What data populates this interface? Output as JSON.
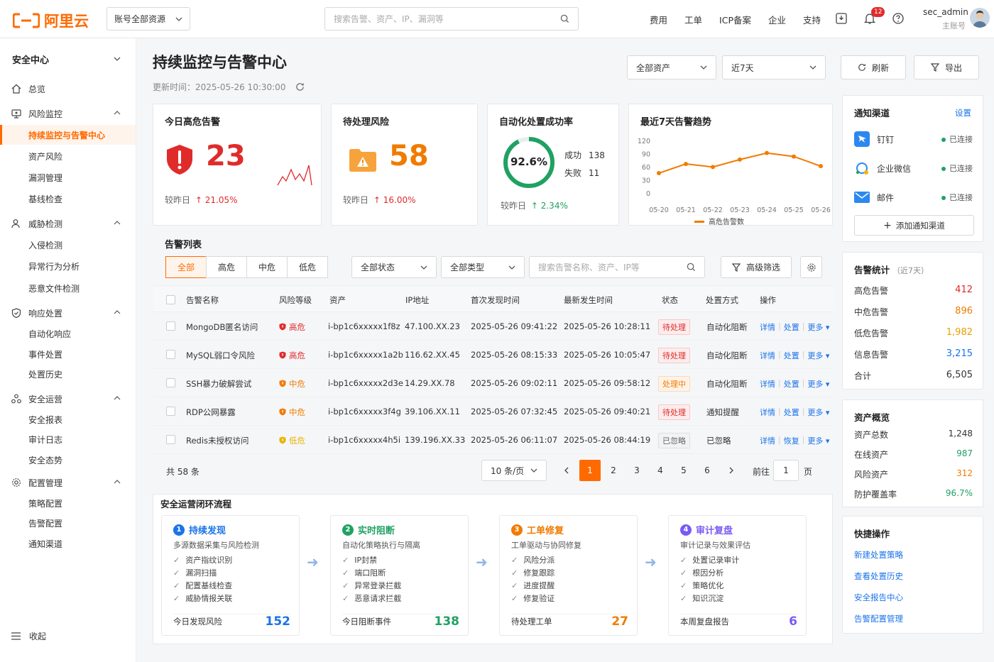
{
  "brand": {
    "name": "阿里云",
    "accent": "#ff6a00"
  },
  "topbar": {
    "account_select": "账号全部资源",
    "search_placeholder": "搜索告警、资产、IP、漏洞等",
    "nav": [
      "费用",
      "工单",
      "ICP备案",
      "企业",
      "支持"
    ],
    "badge": "12",
    "user": {
      "name": "sec_admin",
      "role": "主账号"
    }
  },
  "sidebar": {
    "title": "安全中心",
    "items": [
      {
        "label": "总览",
        "icon": "home-icon",
        "type": "top"
      },
      {
        "label": "风险监控",
        "icon": "monitor-icon",
        "type": "group"
      },
      {
        "label": "持续监控与告警中心",
        "type": "sub",
        "active": true
      },
      {
        "label": "资产风险",
        "type": "sub"
      },
      {
        "label": "漏洞管理",
        "type": "sub"
      },
      {
        "label": "基线检查",
        "type": "sub"
      },
      {
        "label": "威胁检测",
        "icon": "user-shield-icon",
        "type": "group"
      },
      {
        "label": "入侵检测",
        "type": "sub"
      },
      {
        "label": "异常行为分析",
        "type": "sub"
      },
      {
        "label": "恶意文件检测",
        "type": "sub"
      },
      {
        "label": "响应处置",
        "icon": "shield-check-icon",
        "type": "group"
      },
      {
        "label": "自动化响应",
        "type": "sub"
      },
      {
        "label": "事件处置",
        "type": "sub"
      },
      {
        "label": "处置历史",
        "type": "sub"
      },
      {
        "label": "安全运营",
        "icon": "ops-icon",
        "type": "group"
      },
      {
        "label": "安全报表",
        "type": "sub"
      },
      {
        "label": "审计日志",
        "type": "sub"
      },
      {
        "label": "安全态势",
        "type": "sub"
      },
      {
        "label": "配置管理",
        "icon": "gear-icon",
        "type": "group"
      },
      {
        "label": "策略配置",
        "type": "sub"
      },
      {
        "label": "告警配置",
        "type": "sub"
      },
      {
        "label": "通知渠道",
        "type": "sub"
      }
    ],
    "collapse": "收起"
  },
  "header": {
    "title": "持续监控与告警中心",
    "updated": "更新时间：2025-05-26 10:30:00",
    "asset_filter": "全部资产",
    "range_filter": "近7天",
    "refresh": "刷新",
    "export": "导出"
  },
  "cards": {
    "high_alert": {
      "title": "今日高危告警",
      "value": "23",
      "cmp_label": "较昨日",
      "cmp_value": "21.05%"
    },
    "pending_risk": {
      "title": "待处理风险",
      "value": "58",
      "cmp_label": "较昨日",
      "cmp_value": "16.00%"
    },
    "auto_rate": {
      "title": "自动化处置成功率",
      "value": "92.6%",
      "success_label": "成功",
      "success_value": "138",
      "fail_label": "失败",
      "fail_value": "11",
      "cmp_label": "较昨日",
      "cmp_value": "2.34%",
      "rate": 0.926
    }
  },
  "chart_data": {
    "type": "line",
    "title": "最近7天告警趋势",
    "x": [
      "05-20",
      "05-21",
      "05-22",
      "05-23",
      "05-24",
      "05-25",
      "05-26"
    ],
    "series": [
      {
        "name": "高危告警数",
        "values": [
          47,
          68,
          61,
          78,
          93,
          85,
          63
        ],
        "color": "#f17b00"
      }
    ],
    "yticks": [
      "120",
      "90",
      "60",
      "30",
      "0"
    ],
    "ylim": [
      0,
      120
    ]
  },
  "alerts": {
    "section_title": "告警列表",
    "tabs": [
      "全部",
      "高危",
      "中危",
      "低危"
    ],
    "status_filter": "全部状态",
    "type_filter": "全部类型",
    "search_placeholder": "搜索告警名称、资产、IP等",
    "adv_filter": "高级筛选",
    "columns": [
      "告警名称",
      "风险等级",
      "资产",
      "IP地址",
      "首次发现时间",
      "最新发生时间",
      "状态",
      "处置方式",
      "操作"
    ],
    "rows": [
      {
        "name": "MongoDB匿名访问",
        "level": "高危",
        "lvcolor": "#e02b2b",
        "asset": "i-bp1c6xxxxx1f8z",
        "ip": "47.100.XX.23",
        "first": "2025-05-26 09:41:22",
        "last": "2025-05-26 10:28:11",
        "status": "待处理",
        "stype": "pending",
        "method": "自动化阻断",
        "op2": "处置"
      },
      {
        "name": "MySQL弱口令风险",
        "level": "高危",
        "lvcolor": "#e02b2b",
        "asset": "i-bp1c6xxxxx1a2b",
        "ip": "116.62.XX.45",
        "first": "2025-05-26 08:15:33",
        "last": "2025-05-26 10:05:47",
        "status": "待处理",
        "stype": "pending",
        "method": "自动化阻断",
        "op2": "处置"
      },
      {
        "name": "SSH暴力破解尝试",
        "level": "中危",
        "lvcolor": "#f17b00",
        "asset": "i-bp1c6xxxxx2d3e",
        "ip": "14.29.XX.78",
        "first": "2025-05-26 09:02:11",
        "last": "2025-05-26 09:58:12",
        "status": "处理中",
        "stype": "doing",
        "method": "自动化阻断",
        "op2": "处置"
      },
      {
        "name": "RDP公网暴露",
        "level": "中危",
        "lvcolor": "#f17b00",
        "asset": "i-bp1c6xxxxx3f4g",
        "ip": "39.106.XX.11",
        "first": "2025-05-26 07:32:45",
        "last": "2025-05-26 09:40:21",
        "status": "待处理",
        "stype": "pending",
        "method": "通知提醒",
        "op2": "处置"
      },
      {
        "name": "Redis未授权访问",
        "level": "低危",
        "lvcolor": "#e8b400",
        "asset": "i-bp1c6xxxxx4h5i",
        "ip": "139.196.XX.33",
        "first": "2025-05-26 06:11:07",
        "last": "2025-05-26 08:44:19",
        "status": "已忽略",
        "stype": "ignored",
        "method": "已忽略",
        "op2": "恢复"
      }
    ],
    "op_detail": "详情",
    "op_more": "更多",
    "total": "共 58 条",
    "page_size": "10 条/页",
    "pages": [
      "1",
      "2",
      "3",
      "4",
      "5",
      "6"
    ],
    "goto_label": "前往",
    "goto_value": "1",
    "goto_unit": "页"
  },
  "flow": {
    "title": "安全运营闭环流程",
    "steps": [
      {
        "num": "1",
        "title": "持续发现",
        "color": "#1a73e8",
        "sub": "多源数据采集与风险检测",
        "items": [
          "资产指纹识别",
          "漏洞扫描",
          "配置基线检查",
          "威胁情报关联"
        ],
        "foot": "今日发现风险",
        "value": "152"
      },
      {
        "num": "2",
        "title": "实时阻断",
        "color": "#20a162",
        "sub": "自动化策略执行与隔离",
        "items": [
          "IP封禁",
          "端口阻断",
          "异常登录拦截",
          "恶意请求拦截"
        ],
        "foot": "今日阻断事件",
        "value": "138"
      },
      {
        "num": "3",
        "title": "工单修复",
        "color": "#f17b00",
        "sub": "工单驱动与协同修复",
        "items": [
          "风险分派",
          "修复跟踪",
          "进度提醒",
          "修复验证"
        ],
        "foot": "待处理工单",
        "value": "27"
      },
      {
        "num": "4",
        "title": "审计复盘",
        "color": "#7a5af5",
        "sub": "审计记录与效果评估",
        "items": [
          "处置记录审计",
          "根因分析",
          "策略优化",
          "知识沉淀"
        ],
        "foot": "本周复盘报告",
        "value": "6"
      }
    ]
  },
  "notify": {
    "title": "通知渠道",
    "settings": "设置",
    "channels": [
      {
        "name": "钉钉",
        "status": "已连接",
        "icon": "dingtalk-icon"
      },
      {
        "name": "企业微信",
        "status": "已连接",
        "icon": "wecom-icon"
      },
      {
        "name": "邮件",
        "status": "已连接",
        "icon": "mail-icon"
      }
    ],
    "add": "添加通知渠道"
  },
  "stats": {
    "title": "告警统计",
    "period": "（近7天）",
    "rows": [
      {
        "label": "高危告警",
        "value": "412",
        "color": "#e02b2b"
      },
      {
        "label": "中危告警",
        "value": "896",
        "color": "#f17b00"
      },
      {
        "label": "低危告警",
        "value": "1,982",
        "color": "#e8a000"
      },
      {
        "label": "信息告警",
        "value": "3,215",
        "color": "#1a73e8"
      },
      {
        "label": "合计",
        "value": "6,505",
        "color": "#333"
      }
    ]
  },
  "assets": {
    "title": "资产概览",
    "rows": [
      {
        "label": "资产总数",
        "value": "1,248",
        "color": "#333"
      },
      {
        "label": "在线资产",
        "value": "987",
        "color": "#20a162"
      },
      {
        "label": "风险资产",
        "value": "312",
        "color": "#f17b00"
      },
      {
        "label": "防护覆盖率",
        "value": "96.7%",
        "color": "#20a162"
      }
    ]
  },
  "quick": {
    "title": "快捷操作",
    "links": [
      "新建处置策略",
      "查看处置历史",
      "安全报告中心",
      "告警配置管理"
    ]
  }
}
